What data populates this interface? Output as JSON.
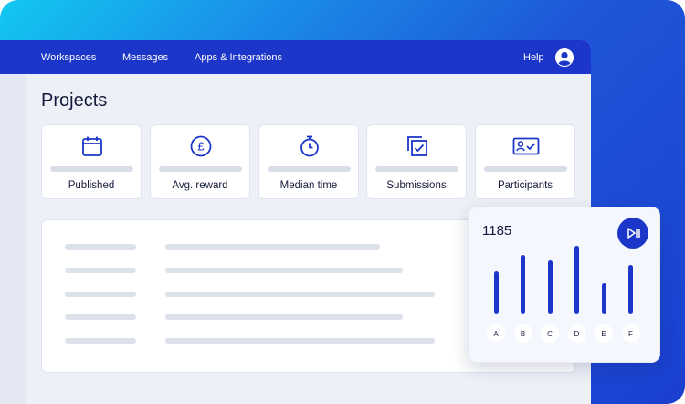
{
  "nav": {
    "items": [
      {
        "label": "Workspaces"
      },
      {
        "label": "Messages"
      },
      {
        "label": "Apps & Integrations"
      }
    ],
    "help_label": "Help",
    "avatar_icon": "user-circle-icon"
  },
  "page": {
    "title": "Projects"
  },
  "stats": [
    {
      "label": "Published",
      "icon": "calendar-icon"
    },
    {
      "label": "Avg. reward",
      "icon": "pound-coin-icon"
    },
    {
      "label": "Median time",
      "icon": "stopwatch-icon"
    },
    {
      "label": "Submissions",
      "icon": "checked-documents-icon"
    },
    {
      "label": "Participants",
      "icon": "id-card-icon"
    }
  ],
  "popup": {
    "value": "1185",
    "play_icon": "play-pause-icon"
  },
  "chart_data": {
    "type": "bar",
    "categories": [
      "A",
      "B",
      "C",
      "D",
      "E",
      "F"
    ],
    "values": [
      0.62,
      0.86,
      0.78,
      1.0,
      0.44,
      0.72
    ],
    "title": "",
    "xlabel": "",
    "ylabel": "",
    "ylim": [
      0,
      1
    ]
  },
  "colors": {
    "brand": "#1b36c8",
    "gradient_start": "#12c8f2",
    "gradient_end": "#1b3fd0"
  }
}
